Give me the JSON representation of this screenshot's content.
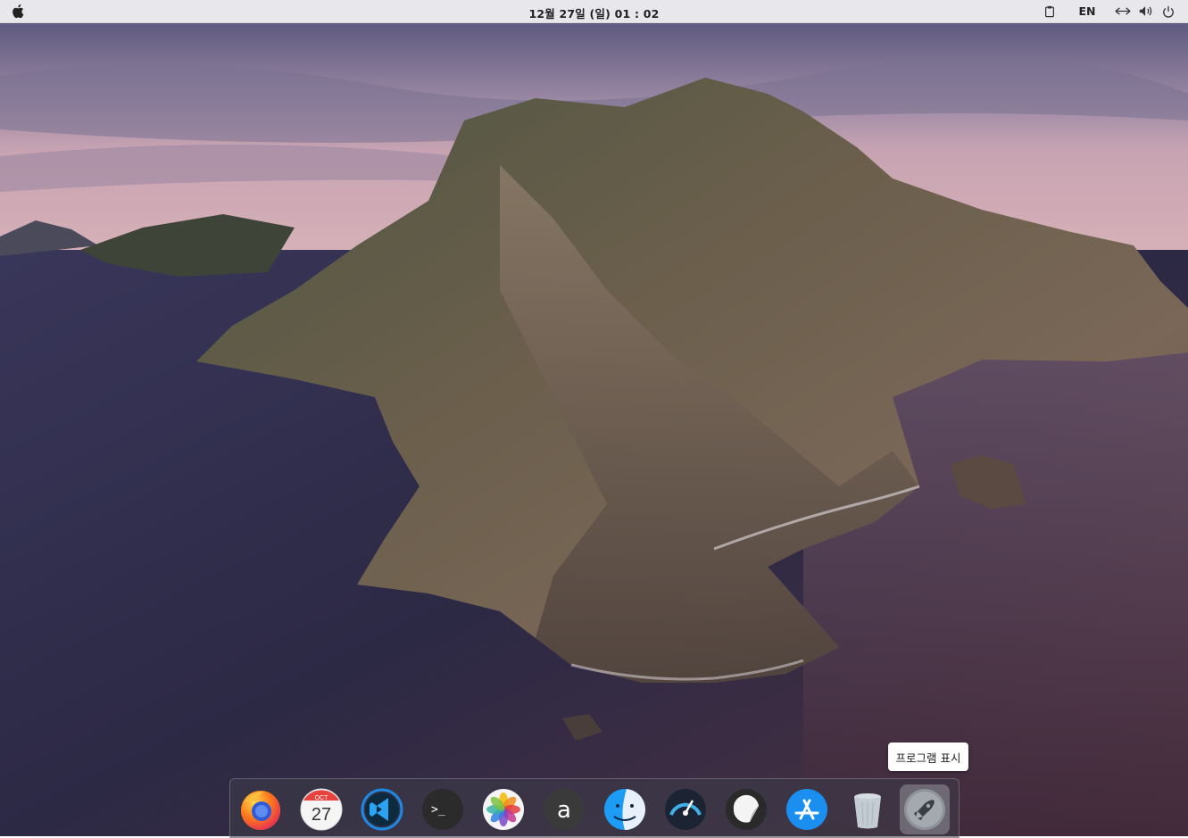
{
  "menubar": {
    "apple_icon": "apple-logo-icon",
    "clock": "12월 27일 (일) 01 : 02",
    "tray": {
      "clipboard_icon": "clipboard-icon",
      "language": "EN",
      "network_icon": "network-icon",
      "volume_icon": "volume-icon",
      "power_icon": "power-icon"
    }
  },
  "tooltip": {
    "text": "프로그램 표시"
  },
  "dock": {
    "items": [
      {
        "name": "Firefox",
        "icon": "firefox-icon"
      },
      {
        "name": "Calendar",
        "icon": "calendar-icon",
        "month": "OCT",
        "day": "27"
      },
      {
        "name": "Visual Studio Code",
        "icon": "vscode-icon"
      },
      {
        "name": "Terminal",
        "icon": "terminal-icon",
        "prompt": ">_"
      },
      {
        "name": "Photos",
        "icon": "photos-icon"
      },
      {
        "name": "App",
        "icon": "a-letter-icon",
        "letter": "a"
      },
      {
        "name": "Finder",
        "icon": "finder-icon"
      },
      {
        "name": "Activity Monitor",
        "icon": "speedometer-icon"
      },
      {
        "name": "Notes",
        "icon": "sticker-icon"
      },
      {
        "name": "App Store",
        "icon": "appstore-icon"
      },
      {
        "name": "Trash",
        "icon": "trash-icon"
      },
      {
        "name": "Launchpad",
        "icon": "rocket-icon",
        "active": true
      }
    ]
  },
  "colors": {
    "menubar_bg": "#ececf0",
    "dock_bg": "#3c3c48",
    "appstore_blue": "#1b8ff0",
    "vscode_blue": "#1e88e5",
    "firefox_orange": "#ff7a1a"
  }
}
